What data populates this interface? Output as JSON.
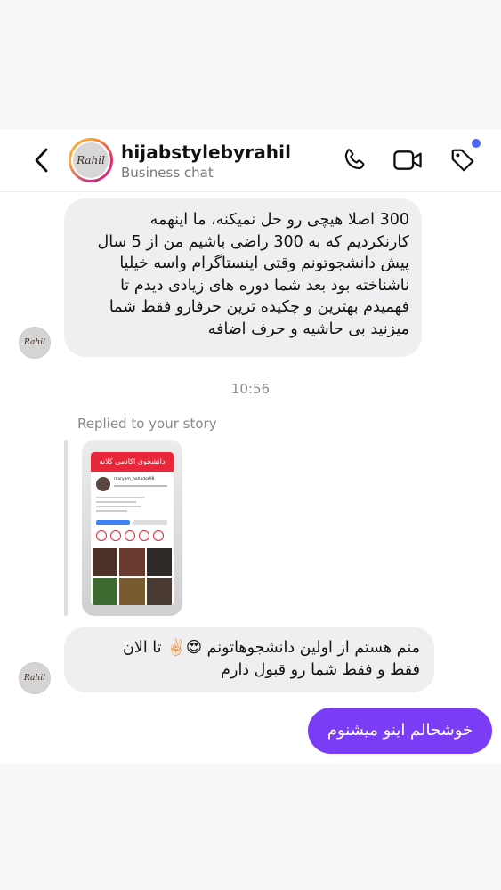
{
  "header": {
    "username": "hijabstylebyrahil",
    "subtitle": "Business chat",
    "avatar_text": "Rahil",
    "icons": [
      "back-icon",
      "phone-icon",
      "video-camera-icon",
      "tag-icon"
    ],
    "notification_dot_color": "#4a66f5"
  },
  "messages": [
    {
      "sender": "other",
      "text": "300 اصلا هیچی رو حل نمیکنه، ما اینهمه\nکارنکردیم که به 300 راضی باشیم من از 5 سال\nپیش دانشجوتونم وقتی اینستاگرام واسه خیلیا\nناشناخته بود بعد شما دوره های زیادی دیدم تا\nفهمیدم بهترین و چکیده ترین حرفارو فقط شما\nمیزنید بی حاشیه و حرف اضافه"
    },
    {
      "sender": "other",
      "text": "منم هستم از اولین دانشجوهاتونم 😍✌🏻 تا الان\nفقط و فقط شما رو قبول دارم"
    },
    {
      "sender": "me",
      "text": "خوشحالم اینو میشنوم"
    }
  ],
  "timestamp": "10:56",
  "story_reply": {
    "label": "Replied to your story",
    "banner_text": "دانشجوی اکادمی کلانه",
    "profile_handle": "maryam_bahador98"
  },
  "colors": {
    "incoming_bubble": "#efeff1",
    "outgoing_bubble": "#7b3cf6",
    "muted_text": "#8a8a8a"
  }
}
